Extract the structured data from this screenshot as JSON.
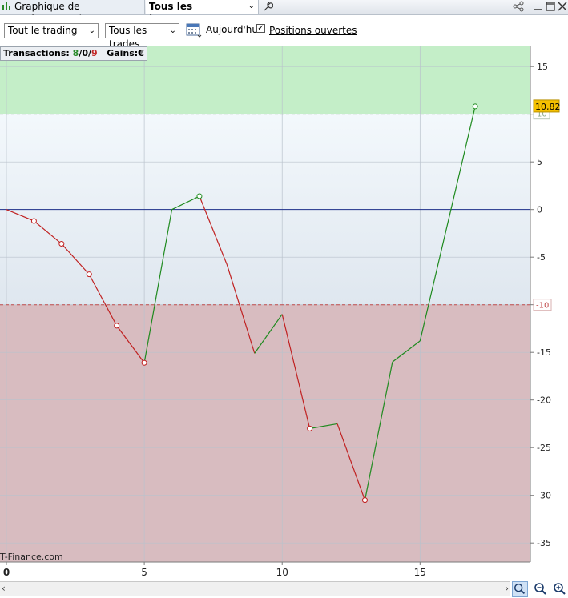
{
  "tabs": {
    "performance_label": "Graphique de performance brute",
    "instruments_label": "Tous les instruments"
  },
  "toolbar": {
    "trading_select": "Tout le trading",
    "trades_select": "Tous les trades",
    "today_label": "Aujourd'hui",
    "open_positions_label": "Positions ouvertes",
    "open_positions_checked": true
  },
  "summary": {
    "transactions_label": "Transactions:",
    "wins": "8",
    "sep1": "/",
    "neutral": "0",
    "sep2": "/",
    "losses": "9",
    "gains_label": "Gains:",
    "gains_value": "€"
  },
  "watermark": "T-Finance.com",
  "chart_data": {
    "type": "line",
    "x": [
      0,
      1,
      2,
      3,
      4,
      5,
      6,
      7,
      8,
      9,
      10,
      11,
      12,
      13,
      14,
      15,
      17
    ],
    "y": [
      0,
      -1.2,
      -3.6,
      -6.8,
      -12.2,
      -16.1,
      0,
      1.4,
      -5.8,
      -15.1,
      -11,
      -23,
      -22.5,
      -30.5,
      -16,
      -13.8,
      10.82
    ],
    "markers": [
      1,
      2,
      3,
      4,
      5,
      7,
      11,
      13,
      17
    ],
    "xlim": [
      0,
      19
    ],
    "ylim": [
      -37,
      17.2
    ],
    "x_ticks": [
      "0",
      "5",
      "10",
      "15"
    ],
    "x_tick_values": [
      0,
      5,
      10,
      15
    ],
    "y_ticks": [
      "15",
      "10",
      "5",
      "0",
      "-5",
      "-10",
      "-15",
      "-20",
      "-25",
      "-30",
      "-35"
    ],
    "y_tick_values": [
      15,
      10,
      5,
      0,
      -5,
      -10,
      -15,
      -20,
      -25,
      -30,
      -35
    ],
    "upper_band": 10,
    "upper_band_label": "10",
    "lower_band": -10,
    "lower_band_label": "-10",
    "last_value_label": "10,82",
    "last_value": 10.82,
    "colors": {
      "up": "#1e8a1e",
      "down": "#c02020",
      "zero_line": "#1f2f8a",
      "upper_zone": "#c4eec8",
      "lower_zone": "#d8bcc0",
      "last_value_badge": "#f5c000"
    }
  }
}
